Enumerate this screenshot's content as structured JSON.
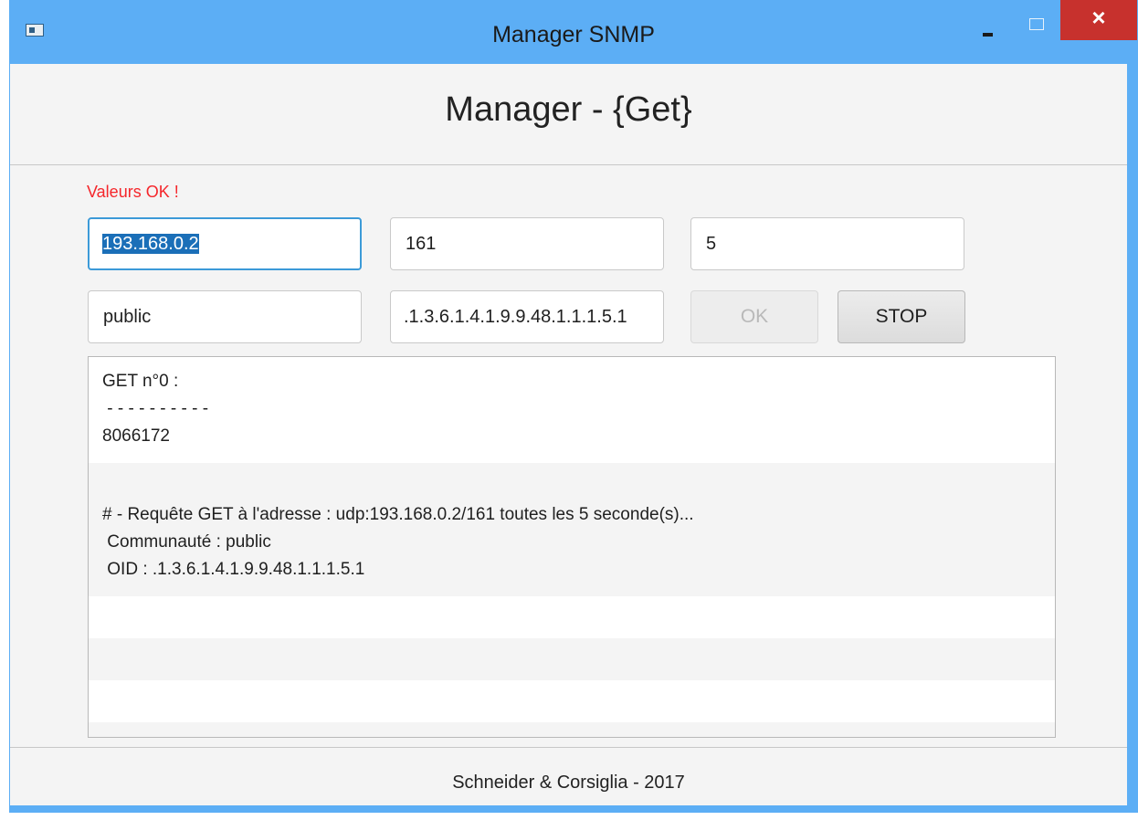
{
  "window": {
    "title": "Manager SNMP",
    "close_glyph": "×"
  },
  "header": {
    "title": "Manager - {Get}"
  },
  "status": {
    "message": "Valeurs OK !",
    "color": "#f5262b"
  },
  "form": {
    "ip_address": "193.168.0.2",
    "port": "161",
    "interval": "5",
    "community": "public",
    "oid": ".1.3.6.1.4.1.9.9.48.1.1.1.5.1",
    "ok_label": "OK",
    "stop_label": "STOP"
  },
  "log": {
    "entries": [
      {
        "lines": [
          "GET n°0 :",
          " - - - - - - - - - -",
          "8066172"
        ]
      },
      {
        "lines": [
          "",
          "# - Requête GET à l'adresse : udp:193.168.0.2/161 toutes les 5 seconde(s)...",
          " Communauté : public",
          " OID : .1.3.6.1.4.1.9.9.48.1.1.1.5.1"
        ]
      }
    ]
  },
  "footer": {
    "text": "Schneider & Corsiglia - 2017"
  },
  "colors": {
    "titlebar": "#5caef5",
    "close_button": "#c7312d",
    "focus_border": "#3c9ad8",
    "selection": "#1b6fb8"
  },
  "icons": {
    "app": "window-app-icon",
    "minimize": "minimize-icon",
    "maximize": "maximize-icon",
    "close": "close-icon"
  }
}
